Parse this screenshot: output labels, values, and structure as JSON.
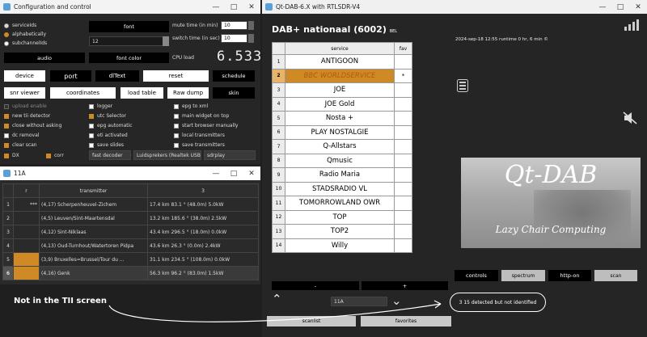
{
  "config": {
    "title": "Configuration and control",
    "radios": [
      "serviceIds",
      "alphabetically",
      "subchannelIds"
    ],
    "font_label": "font",
    "font_size": "12",
    "mute_label": "mute time (in min)",
    "mute_value": "10",
    "switch_label": "switch time (in sec)",
    "switch_value": "10",
    "audio_label": "audio",
    "font_color_label": "font color",
    "cpu_label": "CPU load",
    "cpu_value": "6.533",
    "device_label": "device",
    "port_label": "port",
    "dltext_label": "dlText",
    "reset_label": "reset",
    "schedule_label": "schedule",
    "snr_label": "snr viewer",
    "coordinates_label": "coordinates",
    "loadtable_label": "load table",
    "rawdump_label": "Raw dump",
    "skin_label": "skin",
    "checks": {
      "upload": "upload enable",
      "logger": "logger",
      "epg_xml": "epg to xml",
      "tii": "new tii detector",
      "utc": "utc Selector",
      "main_widget": "main widget on top",
      "close": "close without asking",
      "epg_auto": "epg automatic",
      "browser": "start browser manually",
      "dc": "dc removal",
      "eti": "eti activated",
      "local_tx": "local transmitters",
      "clear_scan": "clear scan",
      "slides": "save slides",
      "save_tx": "save transmitters",
      "dx": "DX",
      "corr": "corr"
    },
    "fast_decoder": "fast decoder",
    "speakers": "Luidsprekers (Realtek USB2.0",
    "sdrplay": "sdrplay"
  },
  "tii": {
    "title": "11A",
    "headers": [
      "r",
      "transmitter",
      "3"
    ],
    "rows": [
      {
        "n": "1",
        "r": "***",
        "tx": "(4,17) Scherpenheuvel-Zichem",
        "info": "17.4 km 83.1 °  (48.0m)  5.0kW"
      },
      {
        "n": "2",
        "r": "",
        "tx": "(4,5) Leuven/Sint-Maartensdal",
        "info": "13.2 km 185.6 °  (38.0m)  2.5kW"
      },
      {
        "n": "3",
        "r": "",
        "tx": "(4,12) Sint-Niklaas",
        "info": "43.4 km 296.5 °  (18.0m)  0.0kW"
      },
      {
        "n": "4",
        "r": "",
        "tx": "(4,13) Oud-Turnhout/Watertoren Pidpa",
        "info": "43.6 km 26.3 °  (0.0m)  2.4kW"
      },
      {
        "n": "5",
        "r": "",
        "tx": "(3,9) Bruxelles=Brussel/Tour du ...",
        "info": "31.1 km 234.5 °  (108.0m)  0.0kW"
      },
      {
        "n": "6",
        "r": "",
        "tx": "(4,16) Genk",
        "info": "56.3 km 96.2 °  (83.0m)  1.5kW"
      }
    ]
  },
  "main": {
    "title": "Qt-DAB-6.X with RTLSDR-V4",
    "ensemble": "DAB+ nationaal  (6002)",
    "ensemble_suffix": "BEL",
    "service_header": "service",
    "fav_header": "fav",
    "services": [
      {
        "n": "1",
        "name": "ANTIGOON",
        "fav": ""
      },
      {
        "n": "2",
        "name": "BBC WORLDSERVICE",
        "fav": "*"
      },
      {
        "n": "3",
        "name": "JOE",
        "fav": ""
      },
      {
        "n": "4",
        "name": "JOE Gold",
        "fav": ""
      },
      {
        "n": "5",
        "name": "Nosta +",
        "fav": ""
      },
      {
        "n": "6",
        "name": "PLAY NOSTALGIE",
        "fav": ""
      },
      {
        "n": "7",
        "name": "Q-Allstars",
        "fav": ""
      },
      {
        "n": "8",
        "name": "Qmusic",
        "fav": ""
      },
      {
        "n": "9",
        "name": "Radio Maria",
        "fav": ""
      },
      {
        "n": "10",
        "name": "STADSRADIO VL",
        "fav": ""
      },
      {
        "n": "11",
        "name": "TOMORROWLAND OWR",
        "fav": ""
      },
      {
        "n": "12",
        "name": "TOP",
        "fav": ""
      },
      {
        "n": "13",
        "name": "TOP2",
        "fav": ""
      },
      {
        "n": "14",
        "name": "Willy",
        "fav": ""
      }
    ],
    "datetime": "2024-sep-18  12:55  runtime 0 hr, 6 min  ©",
    "logo_title": "Qt-DAB",
    "logo_sub": "Lazy Chair Computing",
    "controls_label": "controls",
    "spectrum_label": "spectrum",
    "http_label": "http-on",
    "scan_label": "scan",
    "minus_label": "-",
    "plus_label": "+",
    "channel": "11A",
    "status": "3 15 detected but not identified",
    "scanlist_label": "scanlist",
    "favorites_label": "favorites"
  },
  "annotation": "Not in the TII screen",
  "colors": {
    "accent": "#d08a25",
    "selected_text": "#b05a10"
  }
}
